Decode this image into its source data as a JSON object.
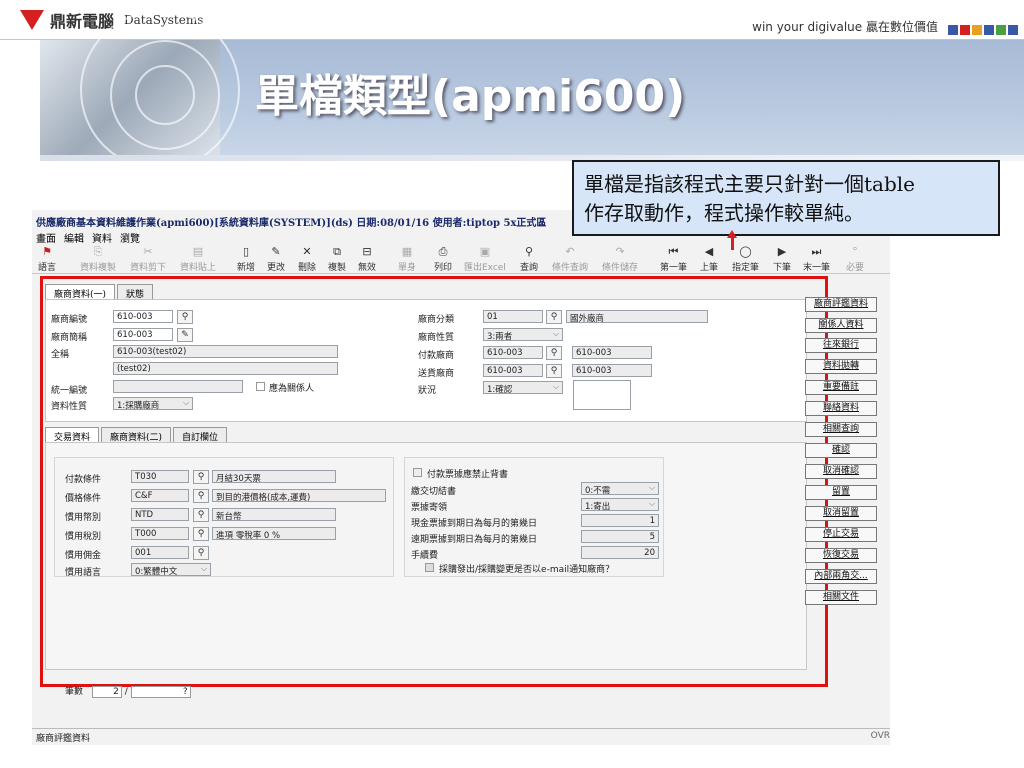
{
  "slide": {
    "logo_cn": "鼎新電腦",
    "logo_en": "DataSystems",
    "slogan": "win your digivalue 贏在數位價值",
    "title": "單檔類型(apmi600)",
    "brand_colors": [
      "#3a58a8",
      "#d42020",
      "#e8a020",
      "#3a58a8",
      "#4aa040",
      "#3a58a8"
    ]
  },
  "callout": {
    "line1": "單檔是指該程式主要只針對一個table",
    "line2": "作存取動作，程式操作較單純。"
  },
  "app": {
    "window_title": "供應廠商基本資料維護作業(apmi600)[系統資料庫(SYSTEM)](ds) 日期:08/01/16 使用者:tiptop 5x正式區",
    "menu": [
      "畫面",
      "編輯",
      "資料",
      "瀏覽"
    ],
    "toolbar": [
      {
        "label": "語言",
        "icon": "flag-icon"
      },
      {
        "label": "資料複製",
        "icon": "copy-icon"
      },
      {
        "label": "資料剪下",
        "icon": "cut-icon"
      },
      {
        "label": "資料貼上",
        "icon": "paste-icon"
      },
      {
        "label": "新增",
        "icon": "new-icon"
      },
      {
        "label": "更改",
        "icon": "edit-icon"
      },
      {
        "label": "刪除",
        "icon": "delete-icon"
      },
      {
        "label": "複製",
        "icon": "duplicate-icon"
      },
      {
        "label": "無效",
        "icon": "invalid-icon"
      },
      {
        "label": "單身",
        "icon": "detail-icon"
      },
      {
        "label": "列印",
        "icon": "print-icon"
      },
      {
        "label": "匯出Excel",
        "icon": "excel-icon"
      },
      {
        "label": "查詢",
        "icon": "query-icon"
      },
      {
        "label": "條件查詢",
        "icon": "cond-query-icon"
      },
      {
        "label": "條件儲存",
        "icon": "cond-save-icon"
      },
      {
        "label": "第一筆",
        "icon": "first-icon"
      },
      {
        "label": "上筆",
        "icon": "prev-icon"
      },
      {
        "label": "指定筆",
        "icon": "goto-icon"
      },
      {
        "label": "下筆",
        "icon": "next-icon"
      },
      {
        "label": "末一筆",
        "icon": "last-icon"
      },
      {
        "label": "必要",
        "icon": "required-icon"
      }
    ],
    "top_tabs": [
      "廠商資料(一)",
      "狀態"
    ],
    "top": {
      "vendor_no_label": "廠商編號",
      "vendor_no": "610-003",
      "vendor_short_label": "廠商簡稱",
      "vendor_short": "610-003",
      "full_name_label": "全稱",
      "full_name_1": "610-003(test02)",
      "full_name_2": "(test02)",
      "tax_id_label": "統一編號",
      "tax_id": "",
      "related_label": "應為關係人",
      "data_type_label": "資料性質",
      "data_type": "1:採購廠商",
      "category_label": "廠商分類",
      "category": "01",
      "category_desc": "國外廠商",
      "nature_label": "廠商性質",
      "nature": "3:兩者",
      "pay_vendor_label": "付款廠商",
      "pay_vendor": "610-003",
      "pay_vendor_desc": "610-003",
      "ship_vendor_label": "送貨廠商",
      "ship_vendor": "610-003",
      "ship_vendor_desc": "610-003",
      "status_label": "狀況",
      "status": "1:確認"
    },
    "bottom_tabs": [
      "交易資料",
      "廠商資料(二)",
      "自訂欄位"
    ],
    "trade": {
      "pay_terms_label": "付款條件",
      "pay_terms": "T030",
      "pay_terms_desc": "月結30天票",
      "price_terms_label": "價格條件",
      "price_terms": "C&F",
      "price_terms_desc": "到目的港價格(成本,運費)",
      "currency_label": "慣用幣別",
      "currency": "NTD",
      "currency_desc": "新台幣",
      "tax_label": "慣用稅別",
      "tax": "T000",
      "tax_desc": "進項 零稅率 0 %",
      "commission_label": "慣用佣金",
      "commission": "001",
      "lang_label": "慣用語言",
      "lang": "0:繁體中文",
      "stop_flag_label": "付款票據應禁止背書",
      "settle_label": "繳交切結書",
      "settle": "0:不需",
      "bill_mail_label": "票據寄領",
      "bill_mail": "1:寄出",
      "cash_due_label": "現金票據到期日為每月的第幾日",
      "cash_due": "1",
      "long_due_label": "遠期票據到期日為每月的第幾日",
      "long_due": "5",
      "fee_label": "手續費",
      "fee": "20",
      "email_label": "採購發出/採購變更是否以e-mail通知廠商？"
    },
    "side_buttons": [
      "廠商評鑑資料",
      "關係人資料",
      "往來銀行",
      "資料拋轉",
      "重要備註",
      "聯絡資料",
      "相關查詢",
      "確認",
      "取消確認",
      "留置",
      "取消留置",
      "停止交易",
      "恢復交易",
      "內部兩角交...",
      "相關文件"
    ],
    "record_label": "筆數",
    "record_current": "2",
    "record_total": "?",
    "status_text": "廠商評鑑資料",
    "status_right": "OVR"
  }
}
